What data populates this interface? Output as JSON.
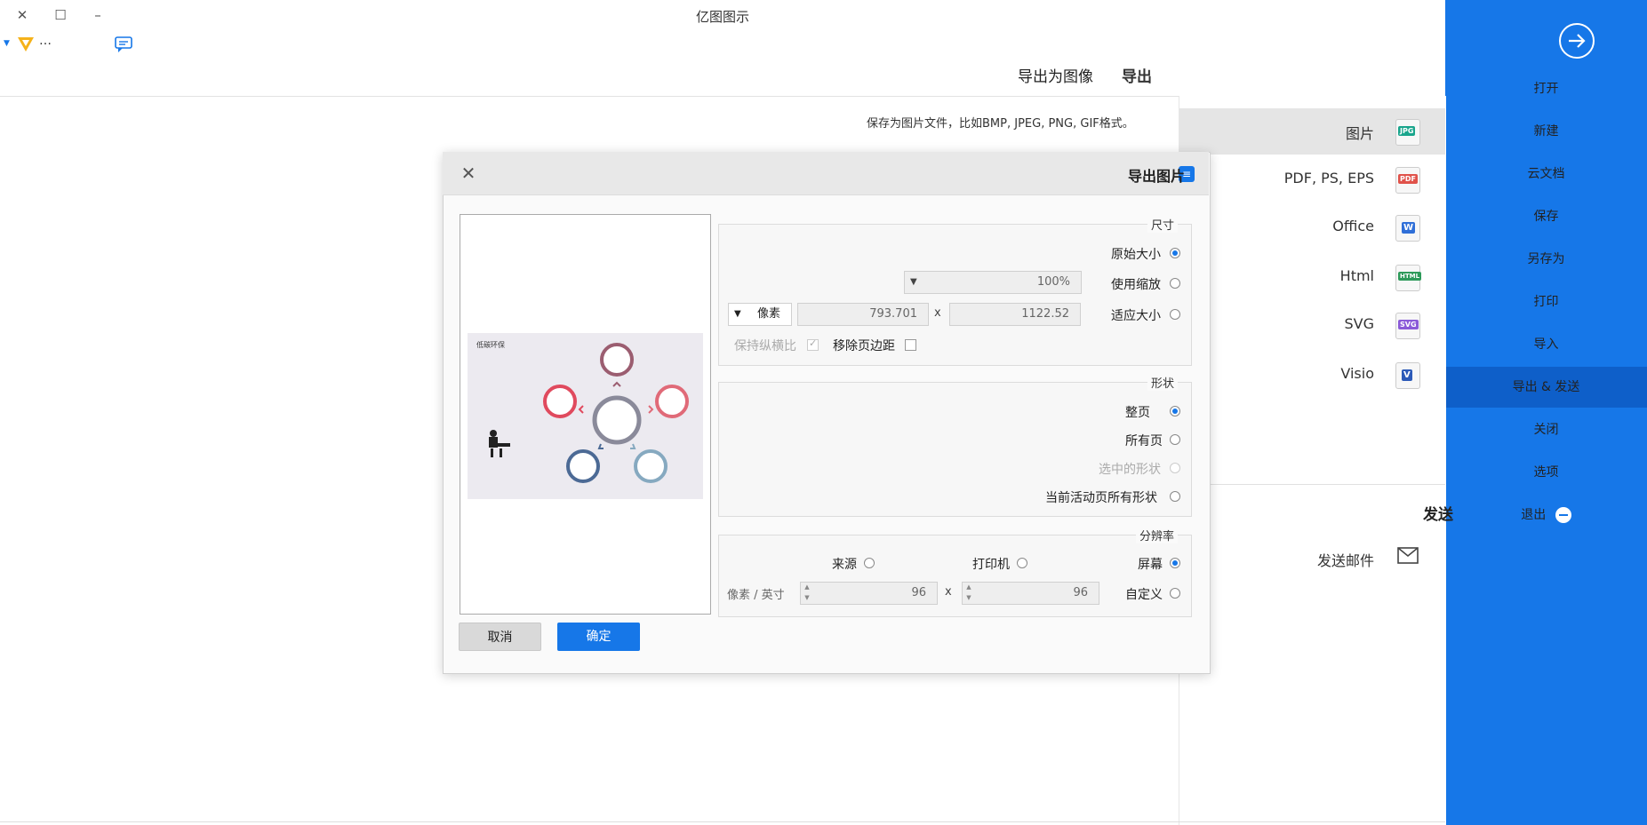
{
  "app": {
    "title": "亿图图示"
  },
  "window_controls": {
    "close": "✕",
    "maximize": "☐",
    "minimize": "–"
  },
  "toolbar": {
    "more": "…"
  },
  "header": {
    "section_title": "导出",
    "content_title": "导出为图像"
  },
  "sidebar": {
    "items": [
      {
        "label": "打开"
      },
      {
        "label": "新建"
      },
      {
        "label": "云文档"
      },
      {
        "label": "保存"
      },
      {
        "label": "另存为"
      },
      {
        "label": "打印"
      },
      {
        "label": "导入"
      },
      {
        "label": "导出 & 发送"
      },
      {
        "label": "关闭"
      },
      {
        "label": "选项"
      },
      {
        "label": "退出"
      }
    ],
    "active": "导出 & 发送",
    "accent_color": "#1677e8"
  },
  "export_categories": [
    {
      "label": "图片",
      "icon": "JPG",
      "color": "#19a58c"
    },
    {
      "label": "PDF, PS, EPS",
      "icon": "PDF",
      "color": "#e0524a"
    },
    {
      "label": "Office",
      "icon": "W",
      "color": "#2f6fd8"
    },
    {
      "label": "Html",
      "icon": "HTML",
      "color": "#2e9a5a"
    },
    {
      "label": "SVG",
      "icon": "SVG",
      "color": "#8a5ad8"
    },
    {
      "label": "Visio",
      "icon": "V",
      "color": "#2c5ab8"
    }
  ],
  "send": {
    "heading": "发送",
    "email": "发送邮件"
  },
  "description": "保存为图片文件，比如BMP, JPEG, PNG, GIF格式。",
  "dialog": {
    "title": "导出图片",
    "logo": "≡",
    "close": "✕",
    "size_group": {
      "title": "尺寸",
      "original": "原始大小",
      "zoom": "使用缩放",
      "zoom_value": "100%",
      "fit": "适应大小",
      "width": "1122.52",
      "height": "793.701",
      "times": "x",
      "unit": "像素",
      "remove_margin": "移除页边距",
      "keep_ratio": "保持纵横比"
    },
    "shape_group": {
      "title": "形状",
      "whole_page": "整页",
      "all_pages": "所有页",
      "selected_shapes": "选中的形状",
      "current_page_shapes": "当前活动页所有形状"
    },
    "resolution_group": {
      "title": "分辨率",
      "screen": "屏幕",
      "printer": "打印机",
      "source": "来源",
      "custom": "自定义",
      "dpi_x": "96",
      "dpi_y": "96",
      "times": "x",
      "unit": "像素 / 英寸"
    },
    "ok": "确定",
    "cancel": "取消",
    "preview_title": "低碳环保"
  }
}
